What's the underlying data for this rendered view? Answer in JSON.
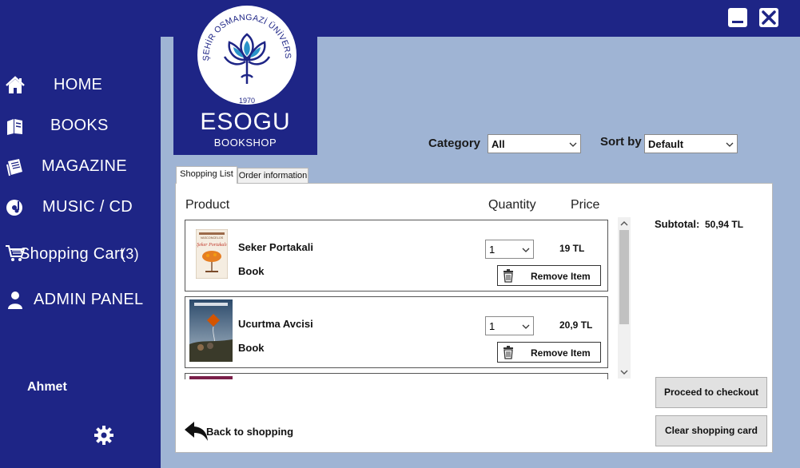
{
  "window": {
    "minimize_icon": "minimize-icon",
    "close_icon": "close-icon"
  },
  "sidebar": {
    "items": [
      {
        "label": "HOME",
        "icon": "home-icon"
      },
      {
        "label": "BOOKS",
        "icon": "books-icon"
      },
      {
        "label": "MAGAZINE",
        "icon": "magazine-icon"
      },
      {
        "label": "MUSIC / CD",
        "icon": "music-cd-icon"
      },
      {
        "label": "Shopping Cart",
        "count": "(3)",
        "icon": "shopping-cart-icon"
      },
      {
        "label": "ADMIN PANEL",
        "icon": "user-icon"
      }
    ],
    "user_name": "Ahmet",
    "settings_icon": "gear-icon"
  },
  "logo": {
    "ring_text": "ESKİŞEHİR OSMANGAZİ ÜNİVERSİTESİ",
    "year": "1970",
    "title": "ESOGU",
    "subtitle": "BOOKSHOP"
  },
  "filters": {
    "category_label": "Category",
    "category_value": "All",
    "sort_label": "Sort by",
    "sort_value": "Default"
  },
  "tabs": [
    {
      "label": "Shopping List",
      "active": true
    },
    {
      "label": "Order information",
      "active": false
    }
  ],
  "cart": {
    "headers": {
      "product": "Product",
      "quantity": "Quantity",
      "price": "Price"
    },
    "items": [
      {
        "name": "Seker Portakali",
        "type": "Book",
        "quantity": "1",
        "price": "19 TL",
        "remove_label": "Remove Item",
        "cover_title": "Şeker Portakalı",
        "cover_author": "VASCONCELOS"
      },
      {
        "name": "Ucurtma Avcisi",
        "type": "Book",
        "quantity": "1",
        "price": "20,9 TL",
        "remove_label": "Remove Item"
      }
    ],
    "subtotal_label": "Subtotal:",
    "subtotal_value": "50,94 TL",
    "checkout_label": "Proceed to checkout",
    "clear_label": "Clear shopping card",
    "back_label": "Back to shopping"
  },
  "colors": {
    "sidebar": "#1e2586",
    "main_bg": "#9fb4d4",
    "panel": "#ffffff"
  }
}
